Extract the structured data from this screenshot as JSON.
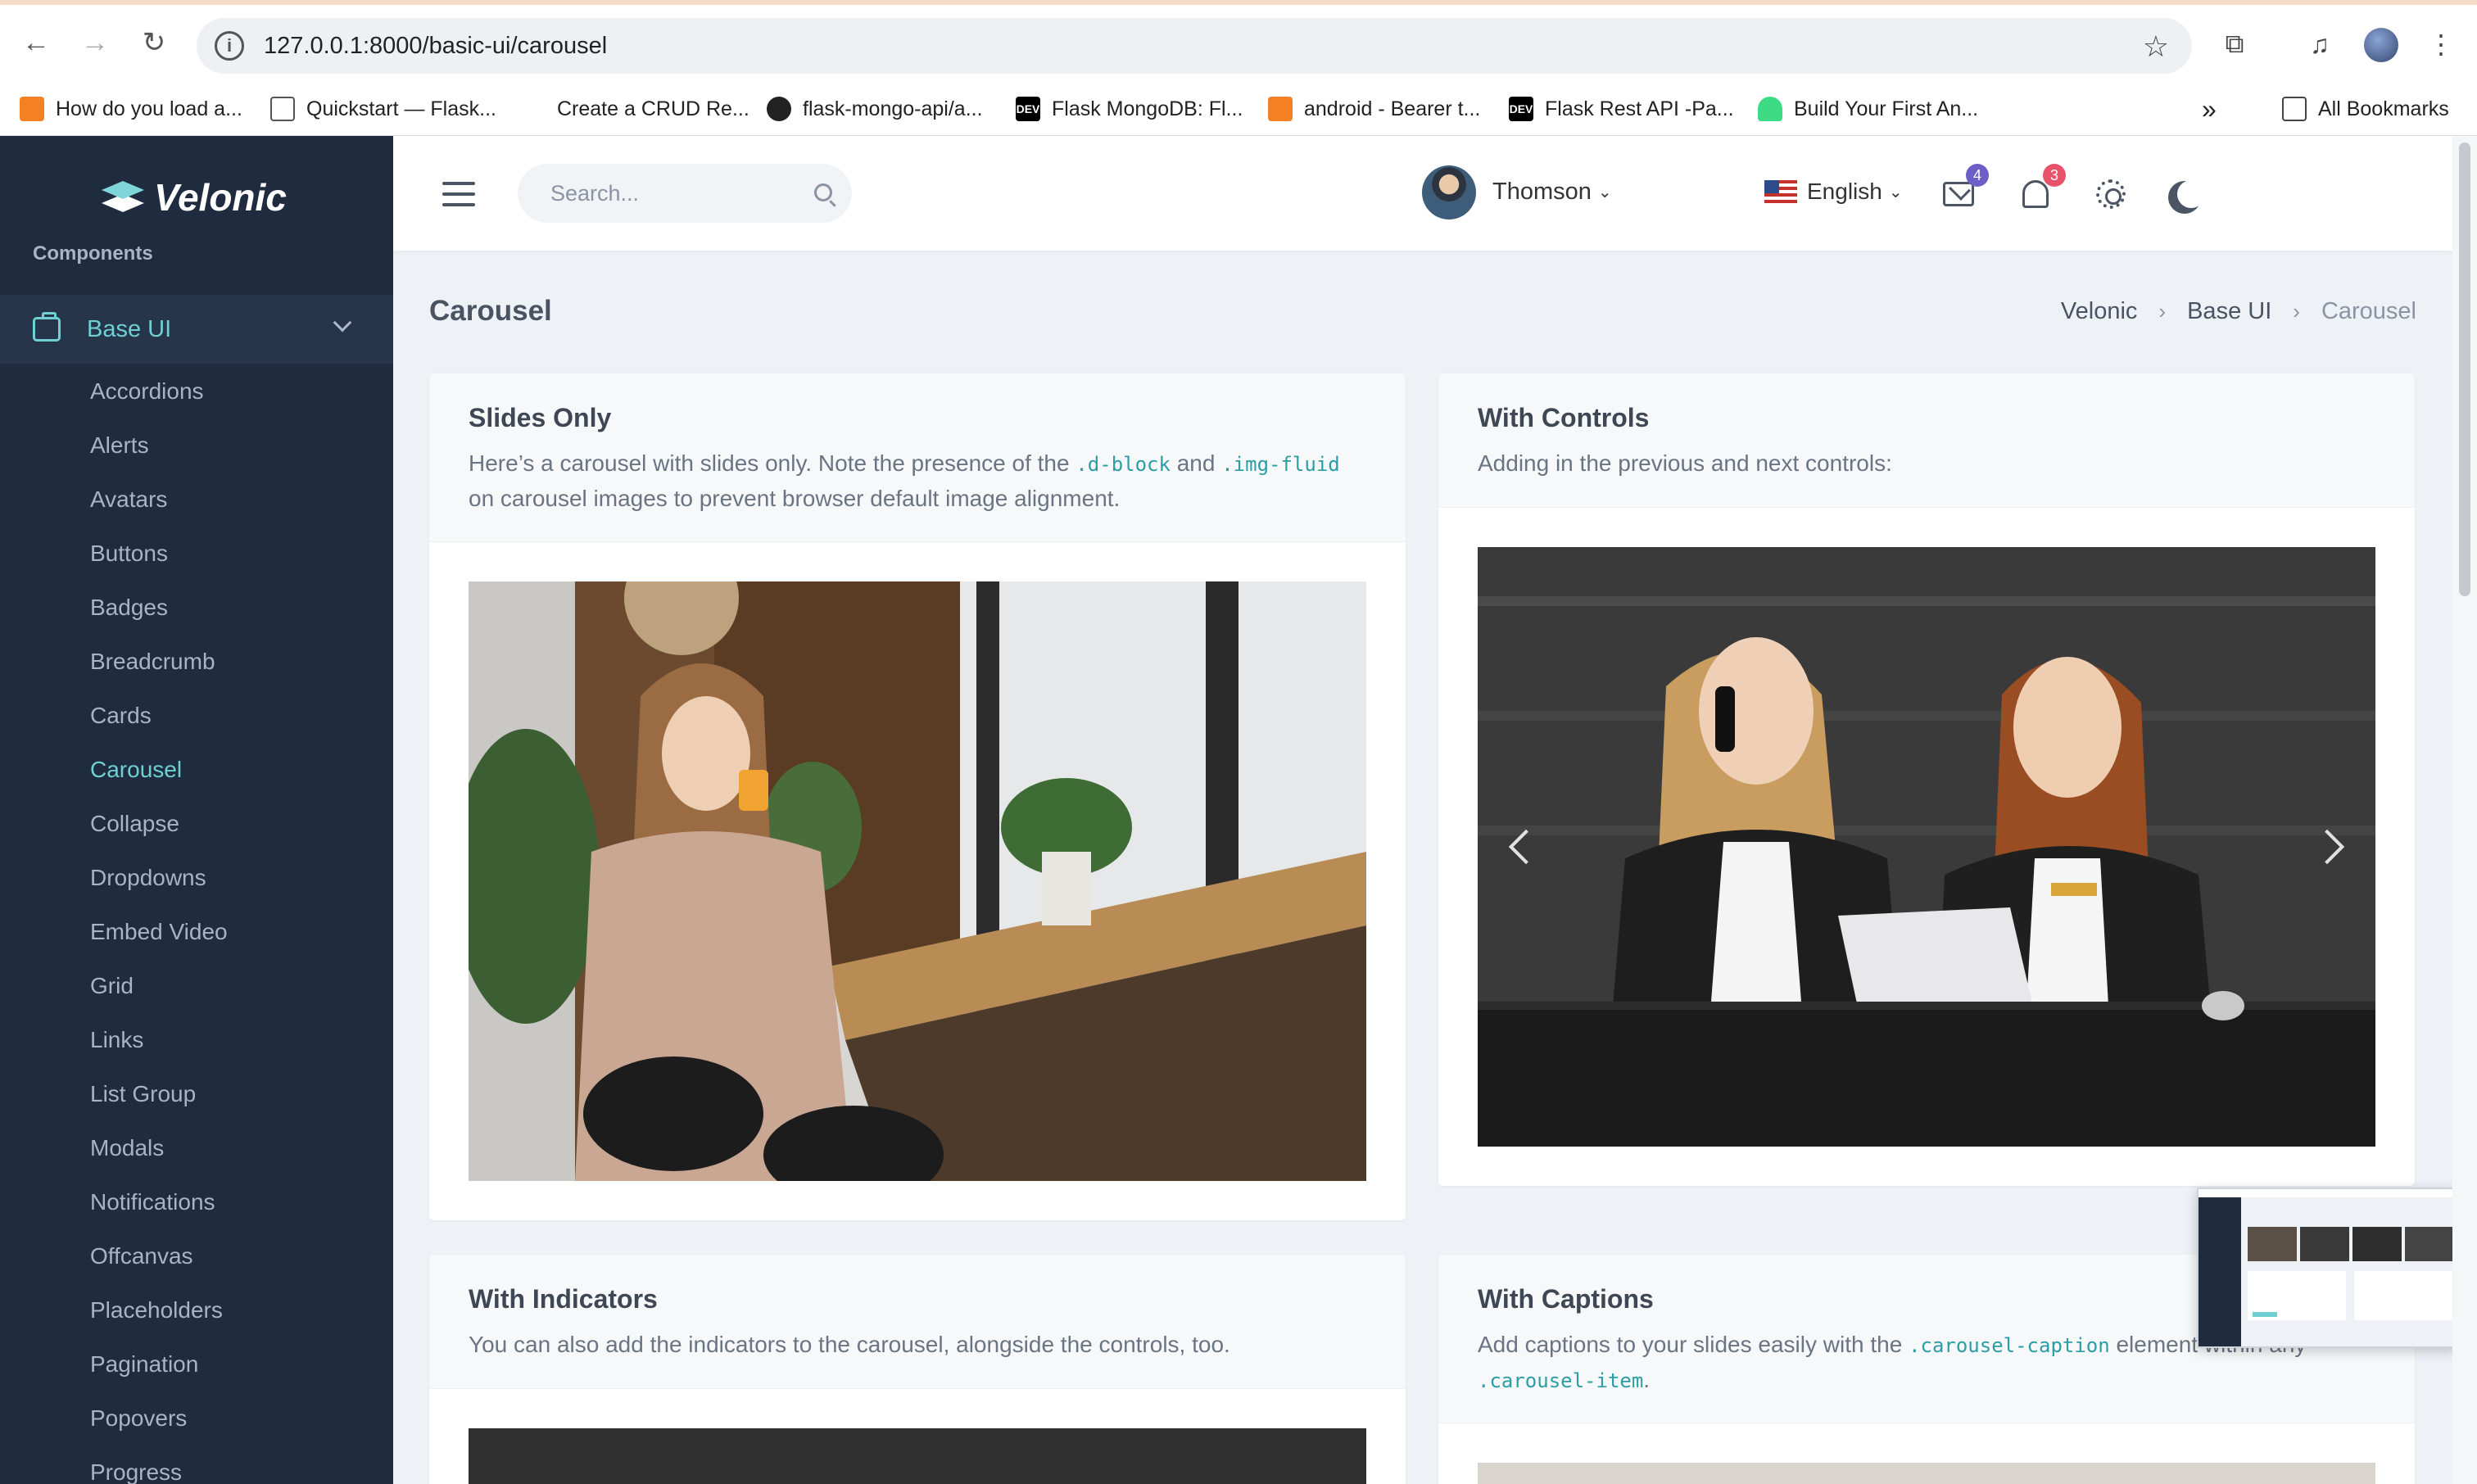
{
  "browser": {
    "url": "127.0.0.1:8000/basic-ui/carousel",
    "bookmarks": [
      "How do you load a...",
      "Quickstart — Flask...",
      "Create a CRUD Re...",
      "flask-mongo-api/a...",
      "Flask MongoDB: Fl...",
      "android - Bearer t...",
      "Flask Rest API -Pa...",
      "Build Your First An..."
    ],
    "bookmark_dev_label": "DEV",
    "more_bookmarks": "»",
    "all_bookmarks": "All Bookmarks"
  },
  "sidebar": {
    "logo": "Velonic",
    "section_label": "Components",
    "active_menu": "Base UI",
    "items": [
      {
        "label": "Accordions"
      },
      {
        "label": "Alerts"
      },
      {
        "label": "Avatars"
      },
      {
        "label": "Buttons"
      },
      {
        "label": "Badges"
      },
      {
        "label": "Breadcrumb"
      },
      {
        "label": "Cards"
      },
      {
        "label": "Carousel",
        "active": true
      },
      {
        "label": "Collapse"
      },
      {
        "label": "Dropdowns"
      },
      {
        "label": "Embed Video"
      },
      {
        "label": "Grid"
      },
      {
        "label": "Links"
      },
      {
        "label": "List Group"
      },
      {
        "label": "Modals"
      },
      {
        "label": "Notifications"
      },
      {
        "label": "Offcanvas"
      },
      {
        "label": "Placeholders"
      },
      {
        "label": "Pagination"
      },
      {
        "label": "Popovers"
      },
      {
        "label": "Progress"
      }
    ]
  },
  "topbar": {
    "search_placeholder": "Search...",
    "language": "English",
    "mail_count": "4",
    "notification_count": "3",
    "user_name": "Thomson",
    "colors": {
      "mail_badge": "#6c5fc7",
      "notification_badge": "#e8526a"
    }
  },
  "page": {
    "title": "Carousel",
    "breadcrumb": [
      "Velonic",
      "Base UI",
      "Carousel"
    ]
  },
  "cards": {
    "slides_only": {
      "title": "Slides Only",
      "desc_part1": "Here’s a carousel with slides only. Note the presence of the",
      "code1": ".d-block",
      "desc_and": "and",
      "code2": ".img-fluid",
      "desc_part2": "on carousel images to prevent browser default image alignment."
    },
    "with_controls": {
      "title": "With Controls",
      "desc": "Adding in the previous and next controls:"
    },
    "with_indicators": {
      "title": "With Indicators",
      "desc": "You can also add the indicators to the carousel, alongside the controls, too."
    },
    "with_captions": {
      "title": "With Captions",
      "desc_part1": "Add captions to your slides easily with the",
      "code1": ".carousel-caption",
      "desc_part2": "element within any",
      "code2": ".carousel-item",
      "desc_end": "."
    }
  },
  "theme": {
    "accent": "#6fd0d3",
    "sidebar_bg": "#1f2b3e",
    "page_bg": "#eef2f7"
  }
}
